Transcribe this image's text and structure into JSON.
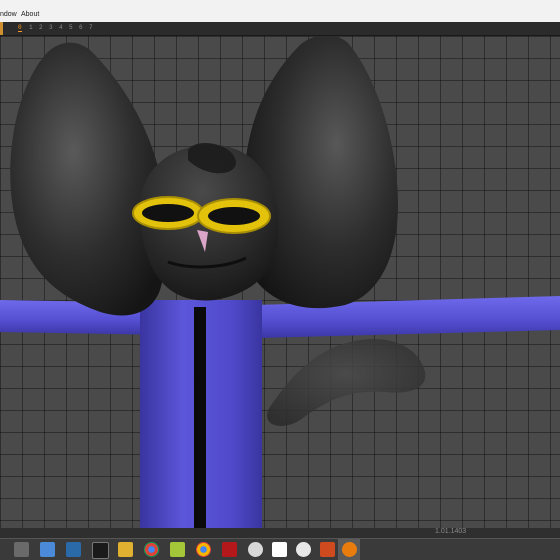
{
  "menubar": {
    "window_label": "ndow",
    "about_label": "About"
  },
  "ruler": {
    "frames": [
      "0",
      "1",
      "2",
      "3",
      "4",
      "5",
      "6",
      "7"
    ],
    "active_frame": "0"
  },
  "status": {
    "version": "1.01.1403"
  },
  "colors": {
    "body_blue": "#5a54d8",
    "character_black": "#2a2a2a",
    "goggle_yellow": "#e2c20a",
    "grid_bg": "#4a4a4a"
  },
  "taskbar": {
    "icons": [
      "pen-icon",
      "app-icon",
      "image-icon",
      "terminal-icon",
      "folder-icon",
      "chrome-icon",
      "android-icon",
      "chrome-icon",
      "filezilla-icon",
      "cloud-icon",
      "document-icon",
      "settings-icon",
      "toolbox-icon",
      "blender-icon"
    ]
  }
}
